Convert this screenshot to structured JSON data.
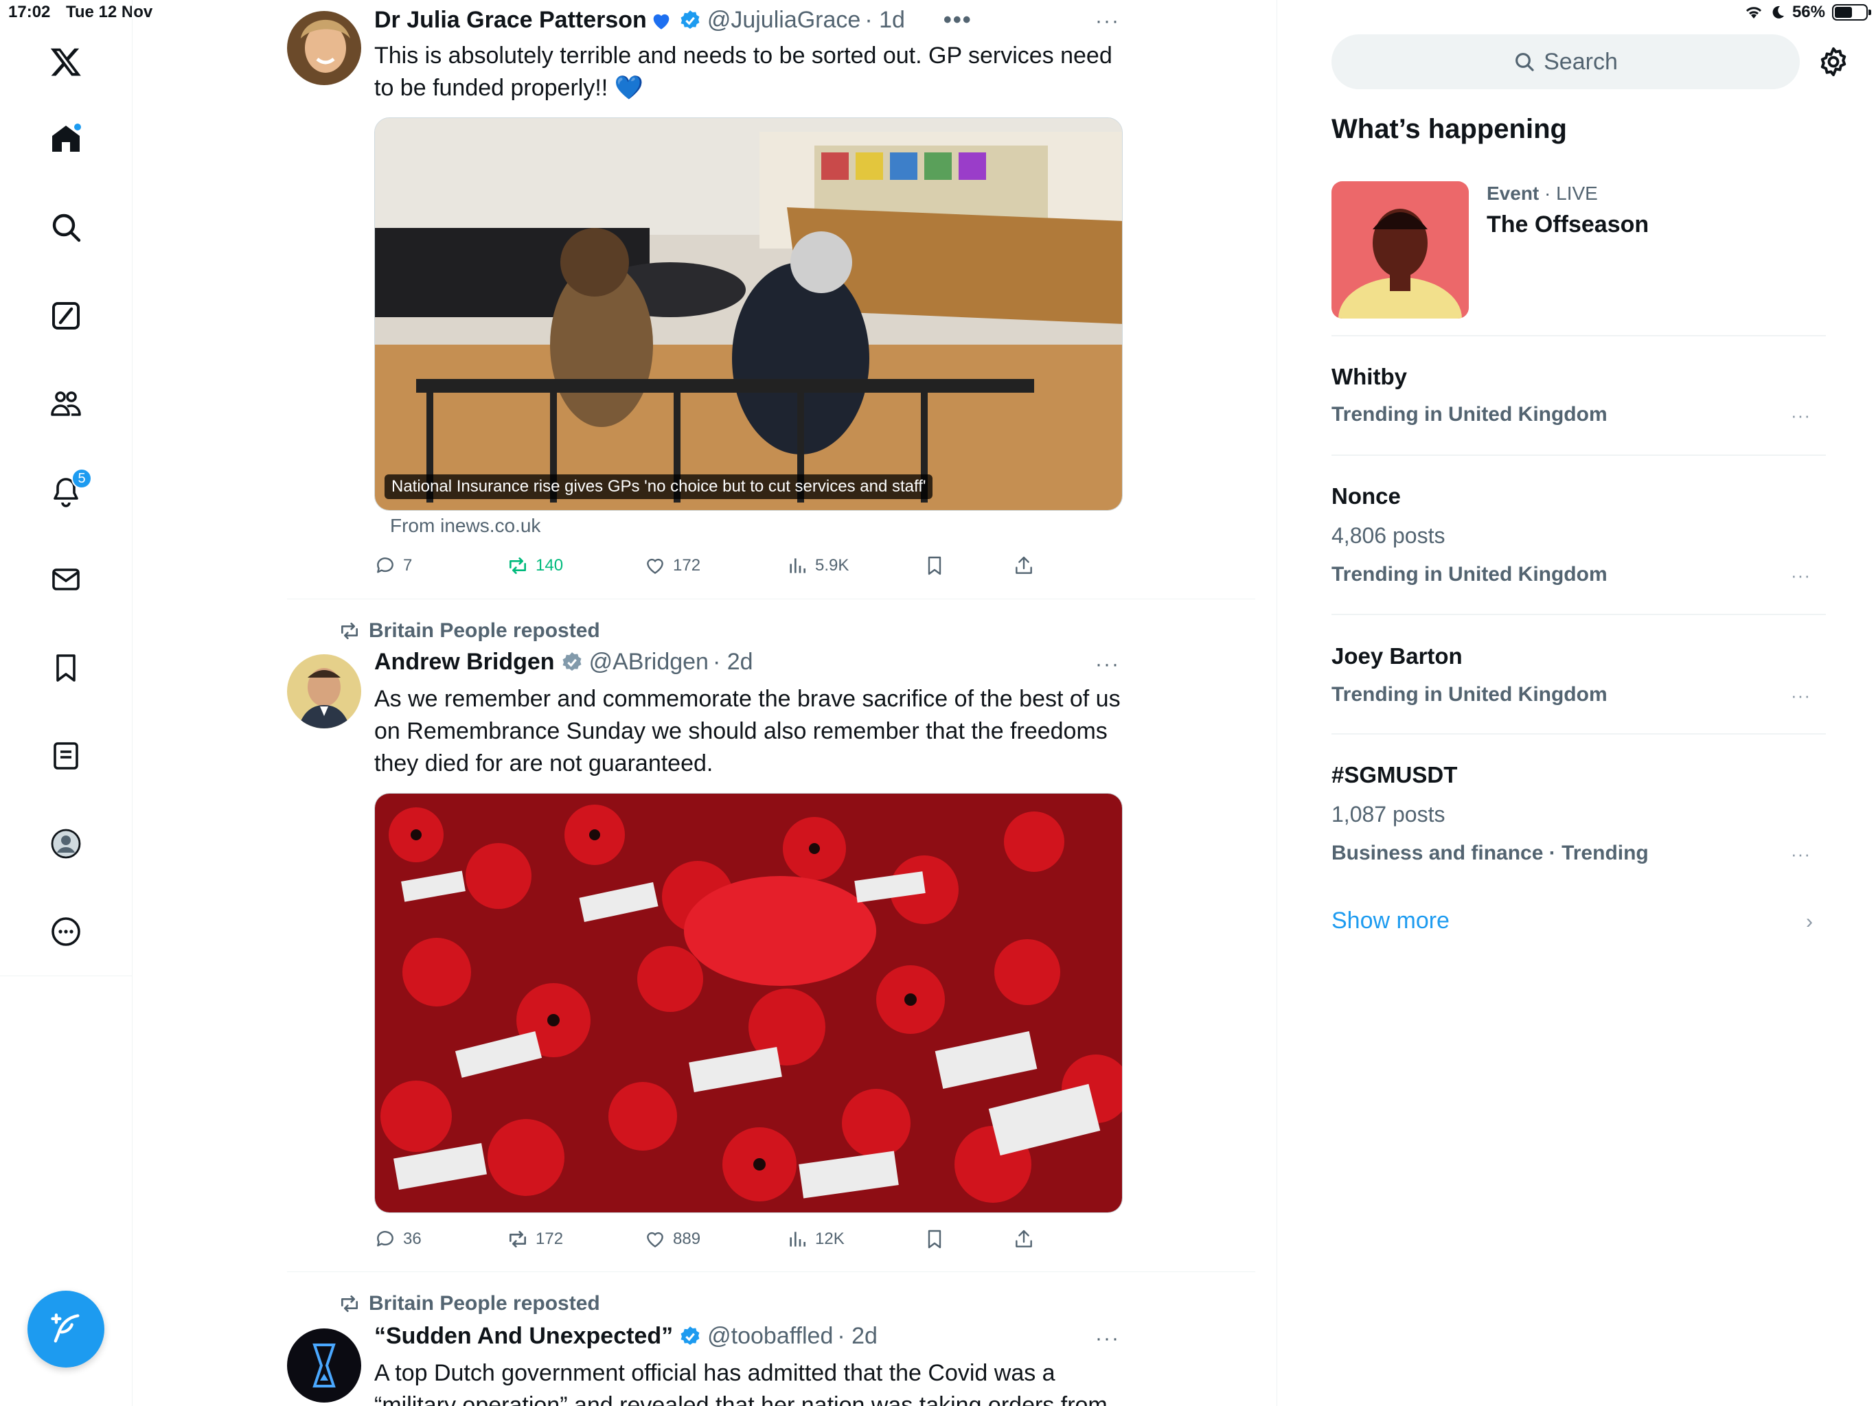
{
  "status_bar": {
    "time": "17:02",
    "date": "Tue 12 Nov",
    "battery": "56%",
    "battery_level": 0.56
  },
  "left_nav": {
    "items": [
      "x-logo",
      "home",
      "explore",
      "grok",
      "communities",
      "notifications",
      "messages",
      "bookmarks",
      "lists",
      "profile",
      "more"
    ],
    "notifications_badge": "5"
  },
  "feed": {
    "tweets": [
      {
        "name": "Dr Julia Grace Patterson",
        "handle": "@JujuliaGrace",
        "time": "· 1d",
        "text": "This is absolutely terrible and needs to be sorted out. GP services need to be funded properly!! 💙",
        "media_caption": "National Insurance rise gives GPs 'no choice but to cut services and staff'",
        "from_link": "From inews.co.uk",
        "stats": {
          "replies": "7",
          "reposts": "140",
          "likes": "172",
          "views": "5.9K"
        }
      },
      {
        "repost_label": "Britain People reposted",
        "name": "Andrew Bridgen",
        "handle": "@ABridgen",
        "time": "· 2d",
        "text": "As we remember and commemorate the brave sacrifice of the best of us on Remembrance Sunday we should also remember that the freedoms they died for are not guaranteed.",
        "stats": {
          "replies": "36",
          "reposts": "172",
          "likes": "889",
          "views": "12K"
        }
      },
      {
        "repost_label": "Britain People reposted",
        "name": "“Sudden And Unexpected”",
        "handle": "@toobaffled",
        "time": "· 2d",
        "text": "A top Dutch government official has admitted that the Covid was a “military operation” and revealed that her nation was taking orders from"
      }
    ]
  },
  "sidebar": {
    "search_placeholder": "Search",
    "whats_happening": "What’s happening",
    "event": {
      "category": "Event",
      "status": "· LIVE",
      "title": "The Offseason"
    },
    "trends": [
      {
        "title": "Whitby",
        "posts": "",
        "context": "Trending in United Kingdom"
      },
      {
        "title": "Nonce",
        "posts": "4,806 posts",
        "context": "Trending in United Kingdom"
      },
      {
        "title": "Joey Barton",
        "posts": "",
        "context": "Trending in United Kingdom"
      },
      {
        "title": "#SGMUSDT",
        "posts": "1,087 posts",
        "context": "Business and finance · Trending"
      }
    ],
    "show_more": "Show more"
  },
  "colors": {
    "accent": "#1d9bf0",
    "text": "#0f1419",
    "muted": "#536471",
    "repost_active": "#00ba7c",
    "divider": "#eff3f4"
  }
}
